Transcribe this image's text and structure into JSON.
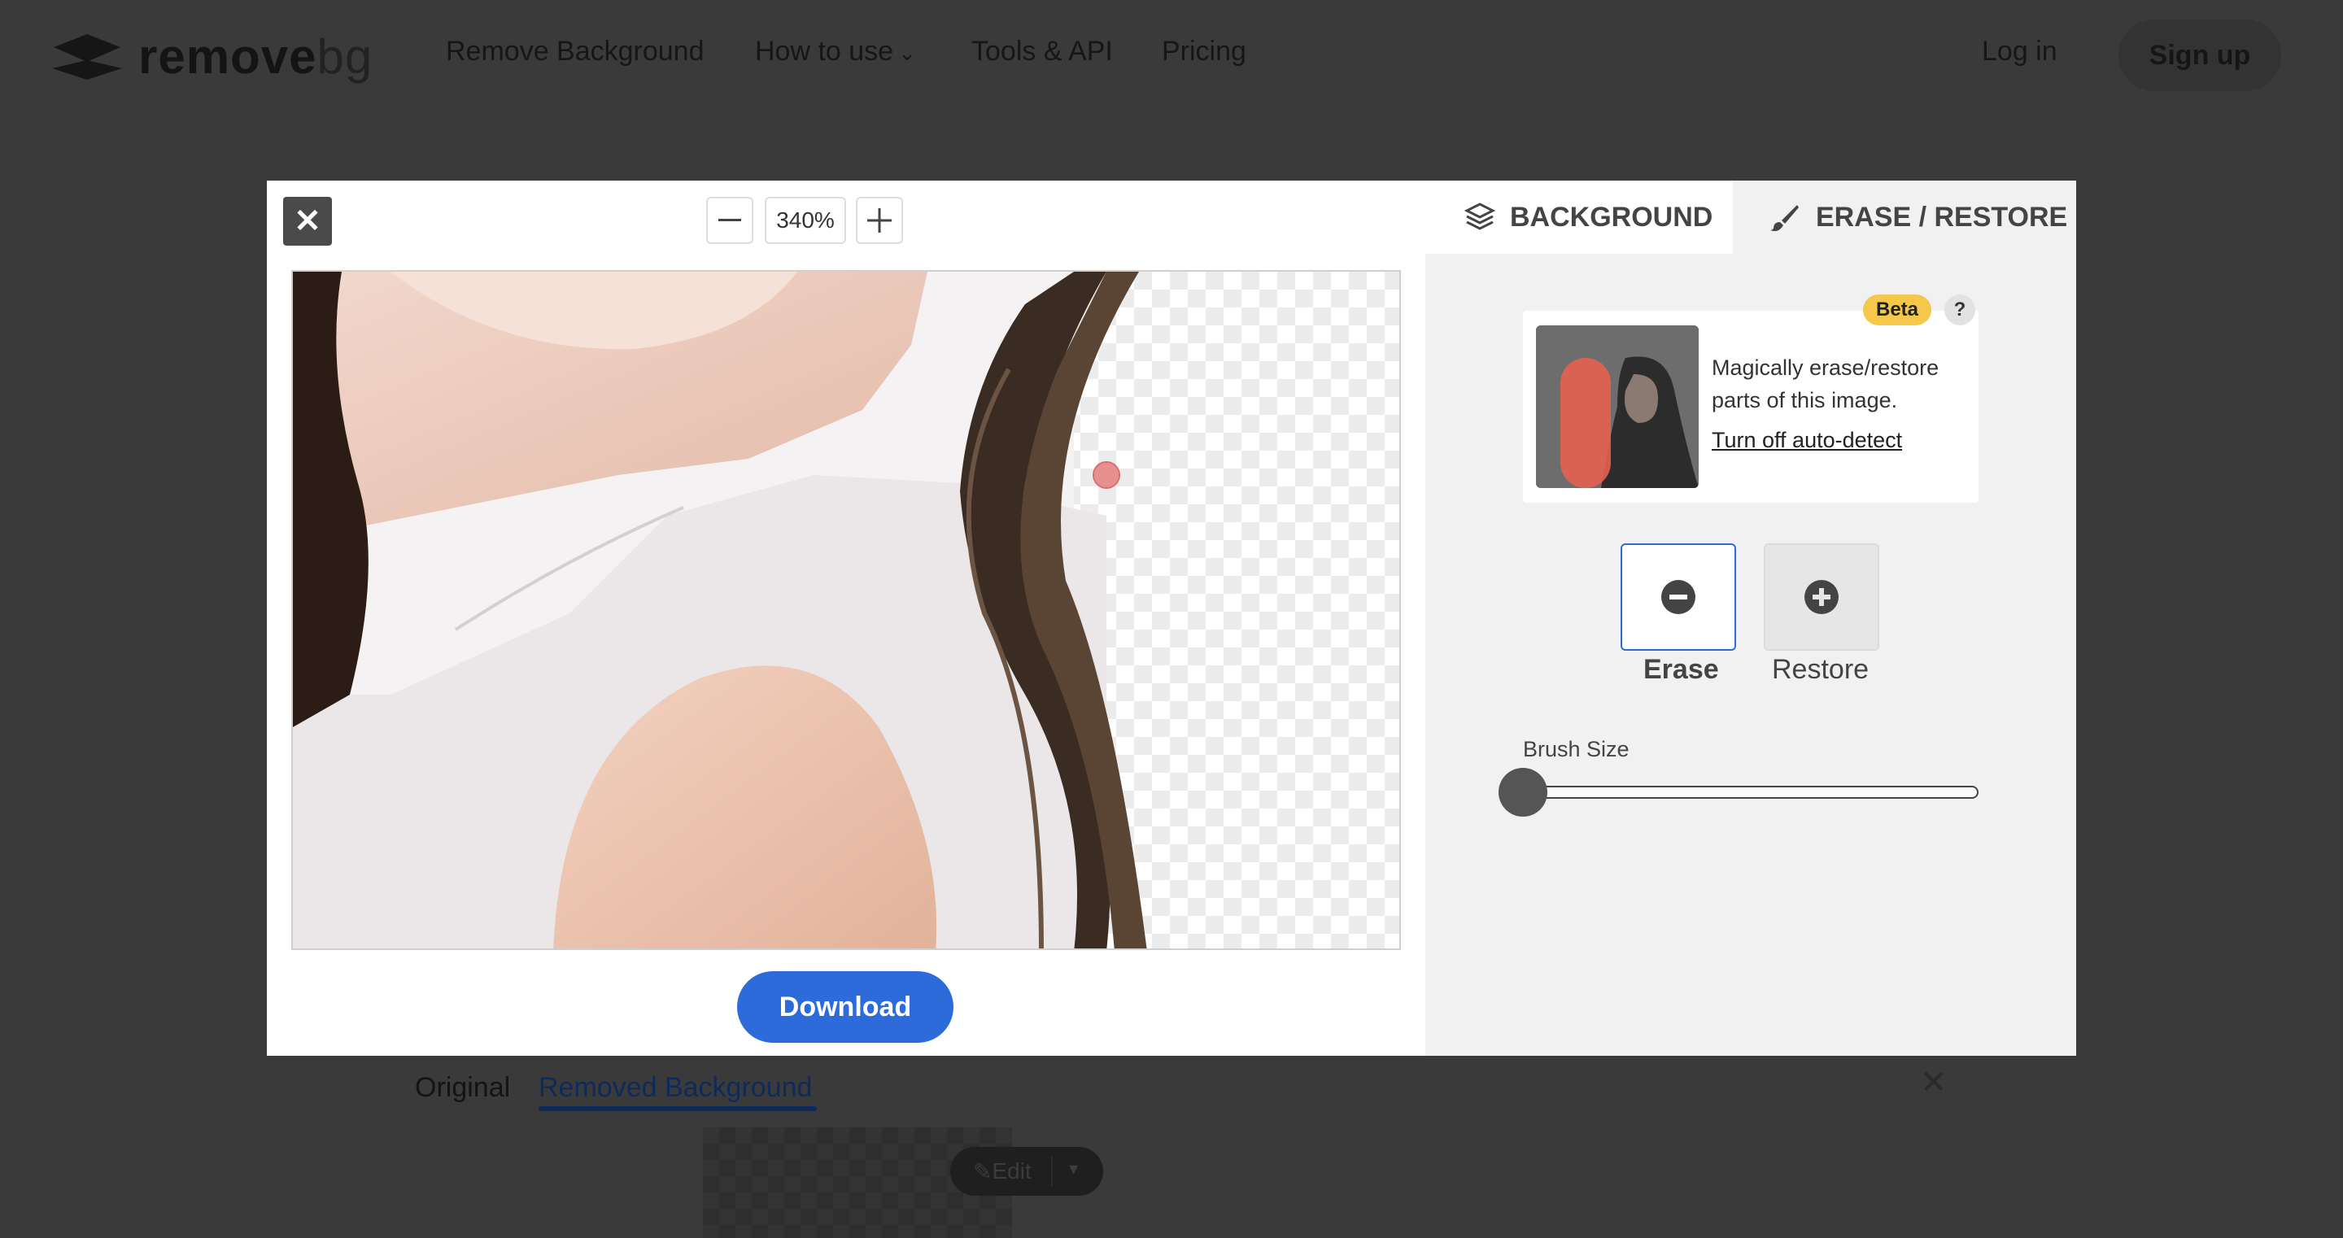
{
  "nav": {
    "logo_text_1": "remove",
    "logo_text_2": "bg",
    "links": [
      "Remove Background",
      "How to use",
      "Tools & API",
      "Pricing"
    ],
    "login": "Log in",
    "signup": "Sign up"
  },
  "page": {
    "tab_original": "Original",
    "tab_removed": "Removed Background",
    "edit_label": "Edit"
  },
  "modal": {
    "zoom_value": "340%",
    "download_label": "Download",
    "tab_background": "BACKGROUND",
    "tab_erase_restore": "ERASE / RESTORE",
    "beta_badge": "Beta",
    "help_label": "?",
    "card_text": "Magically erase/restore parts of this image.",
    "card_link": "Turn off auto-detect",
    "erase_label": "Erase",
    "restore_label": "Restore",
    "brush_size_label": "Brush Size",
    "brush_size_value": 0
  },
  "colors": {
    "accent": "#2d6bdb",
    "beta": "#f5c84b"
  }
}
